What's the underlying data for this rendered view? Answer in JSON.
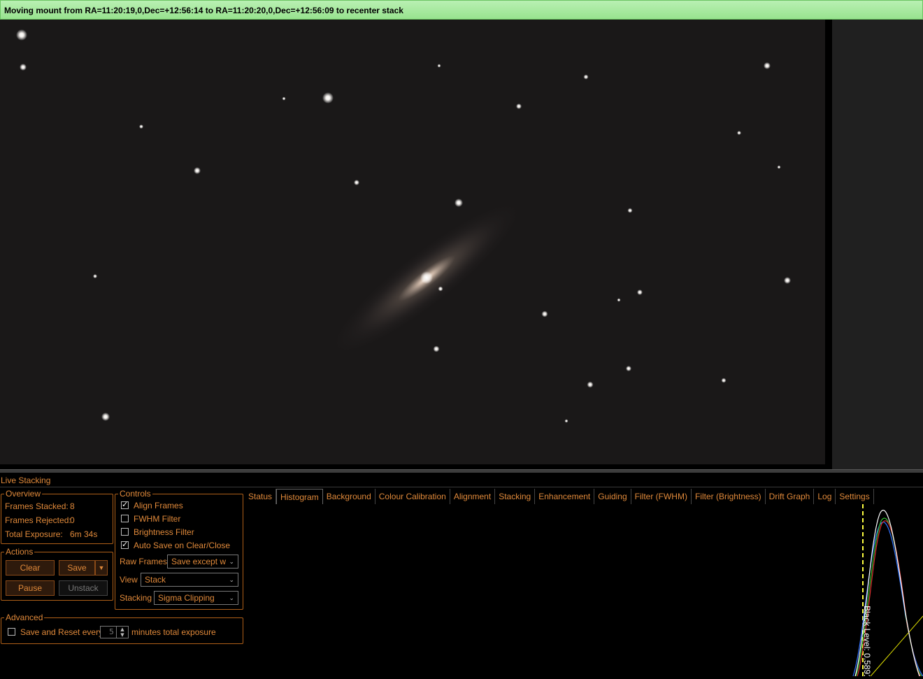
{
  "status_message": "Moving mount from RA=11:20:19,0,Dec=+12:56:14 to RA=11:20:20,0,Dec=+12:56:09 to recenter stack",
  "panel_title": "Live Stacking",
  "overview": {
    "legend": "Overview",
    "frames_stacked_label": "Frames Stacked:",
    "frames_stacked_value": "8",
    "frames_rejected_label": "Frames Rejected:",
    "frames_rejected_value": "0",
    "total_exposure_label": "Total Exposure:",
    "total_exposure_value": "6m 34s"
  },
  "actions": {
    "legend": "Actions",
    "clear": "Clear",
    "save": "Save",
    "pause": "Pause",
    "unstack": "Unstack"
  },
  "controls": {
    "legend": "Controls",
    "align_frames": "Align Frames",
    "align_frames_checked": true,
    "fwhm_filter": "FWHM Filter",
    "fwhm_filter_checked": false,
    "brightness_filter": "Brightness Filter",
    "brightness_filter_checked": false,
    "auto_save": "Auto Save on Clear/Close",
    "auto_save_checked": true,
    "raw_frames_label": "Raw Frames",
    "raw_frames_value": "Save except w",
    "view_label": "View",
    "view_value": "Stack",
    "stacking_label": "Stacking",
    "stacking_value": "Sigma Clipping"
  },
  "advanced": {
    "legend": "Advanced",
    "save_reset_label": "Save and Reset every",
    "save_reset_checked": false,
    "minutes_value": "5",
    "minutes_suffix": "minutes total exposure"
  },
  "tabs": [
    "Status",
    "Histogram",
    "Background",
    "Colour Calibration",
    "Alignment",
    "Stacking",
    "Enhancement",
    "Guiding",
    "Filter (FWHM)",
    "Filter (Brightness)",
    "Drift Graph",
    "Log",
    "Settings"
  ],
  "active_tab": "Histogram",
  "histogram": {
    "black_level_label": "Black Level: 0.5891",
    "colors": {
      "luminance": "#ffffff",
      "red": "#e03030",
      "green": "#30c030",
      "blue": "#3070ff",
      "curve": "#e0e000",
      "marker": "#ffff40"
    }
  },
  "colors": {
    "accent": "#e0893a",
    "status_bg": "#a8ea9f",
    "sky_bg": "#1a1818"
  }
}
